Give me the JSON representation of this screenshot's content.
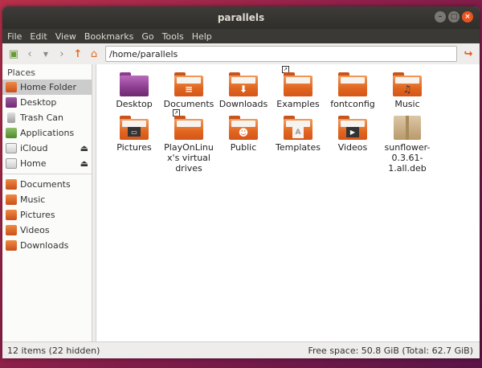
{
  "window": {
    "title": "parallels"
  },
  "menu": [
    "File",
    "Edit",
    "View",
    "Bookmarks",
    "Go",
    "Tools",
    "Help"
  ],
  "toolbar": {
    "path": "/home/parallels"
  },
  "sidebar": {
    "heading": "Places",
    "items": [
      {
        "label": "Home Folder"
      },
      {
        "label": "Desktop"
      },
      {
        "label": "Trash Can"
      },
      {
        "label": "Applications"
      },
      {
        "label": "iCloud"
      },
      {
        "label": "Home"
      },
      {
        "label": "Documents"
      },
      {
        "label": "Music"
      },
      {
        "label": "Pictures"
      },
      {
        "label": "Videos"
      },
      {
        "label": "Downloads"
      }
    ],
    "eject_glyph": "⏏"
  },
  "files": [
    {
      "name": "Desktop"
    },
    {
      "name": "Documents"
    },
    {
      "name": "Downloads"
    },
    {
      "name": "Examples"
    },
    {
      "name": "fontconfig"
    },
    {
      "name": "Music"
    },
    {
      "name": "Pictures"
    },
    {
      "name": "PlayOnLinux's virtual drives"
    },
    {
      "name": "Public"
    },
    {
      "name": "Templates"
    },
    {
      "name": "Videos"
    },
    {
      "name": "sunflower-0.3.61-1.all.deb"
    }
  ],
  "status": {
    "count": "12 items (22 hidden)",
    "space": "Free space: 50.8 GiB (Total: 62.7 GiB)"
  },
  "colors": {
    "accent": "#e95420",
    "folder": "#e0661f",
    "desktop_folder": "#8c3b8f"
  }
}
